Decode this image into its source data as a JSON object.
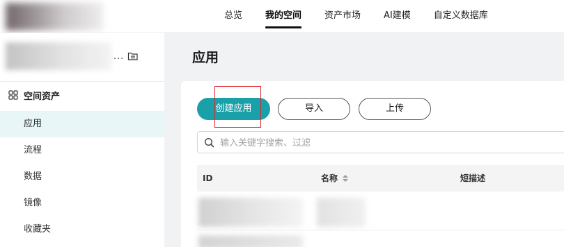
{
  "topnav": {
    "items": [
      {
        "label": "总览"
      },
      {
        "label": "我的空间"
      },
      {
        "label": "资产市场"
      },
      {
        "label": "AI建模"
      },
      {
        "label": "自定义数据库"
      }
    ],
    "active_index": 1
  },
  "sidebar": {
    "space_ellipsis": "...",
    "section_title": "空间资产",
    "items": [
      {
        "label": "应用"
      },
      {
        "label": "流程"
      },
      {
        "label": "数据"
      },
      {
        "label": "镜像"
      },
      {
        "label": "收藏夹"
      }
    ],
    "active_index": 0
  },
  "main": {
    "title": "应用",
    "buttons": {
      "create": "创建应用",
      "import": "导入",
      "upload": "上传"
    },
    "search": {
      "placeholder": "输入关键字搜索、过滤",
      "value": ""
    },
    "table": {
      "columns": [
        "ID",
        "名称",
        "短描述"
      ]
    }
  },
  "colors": {
    "accent": "#1aa0a8",
    "active_nav_bg": "#e8f6f7",
    "highlight": "#d9232a"
  }
}
